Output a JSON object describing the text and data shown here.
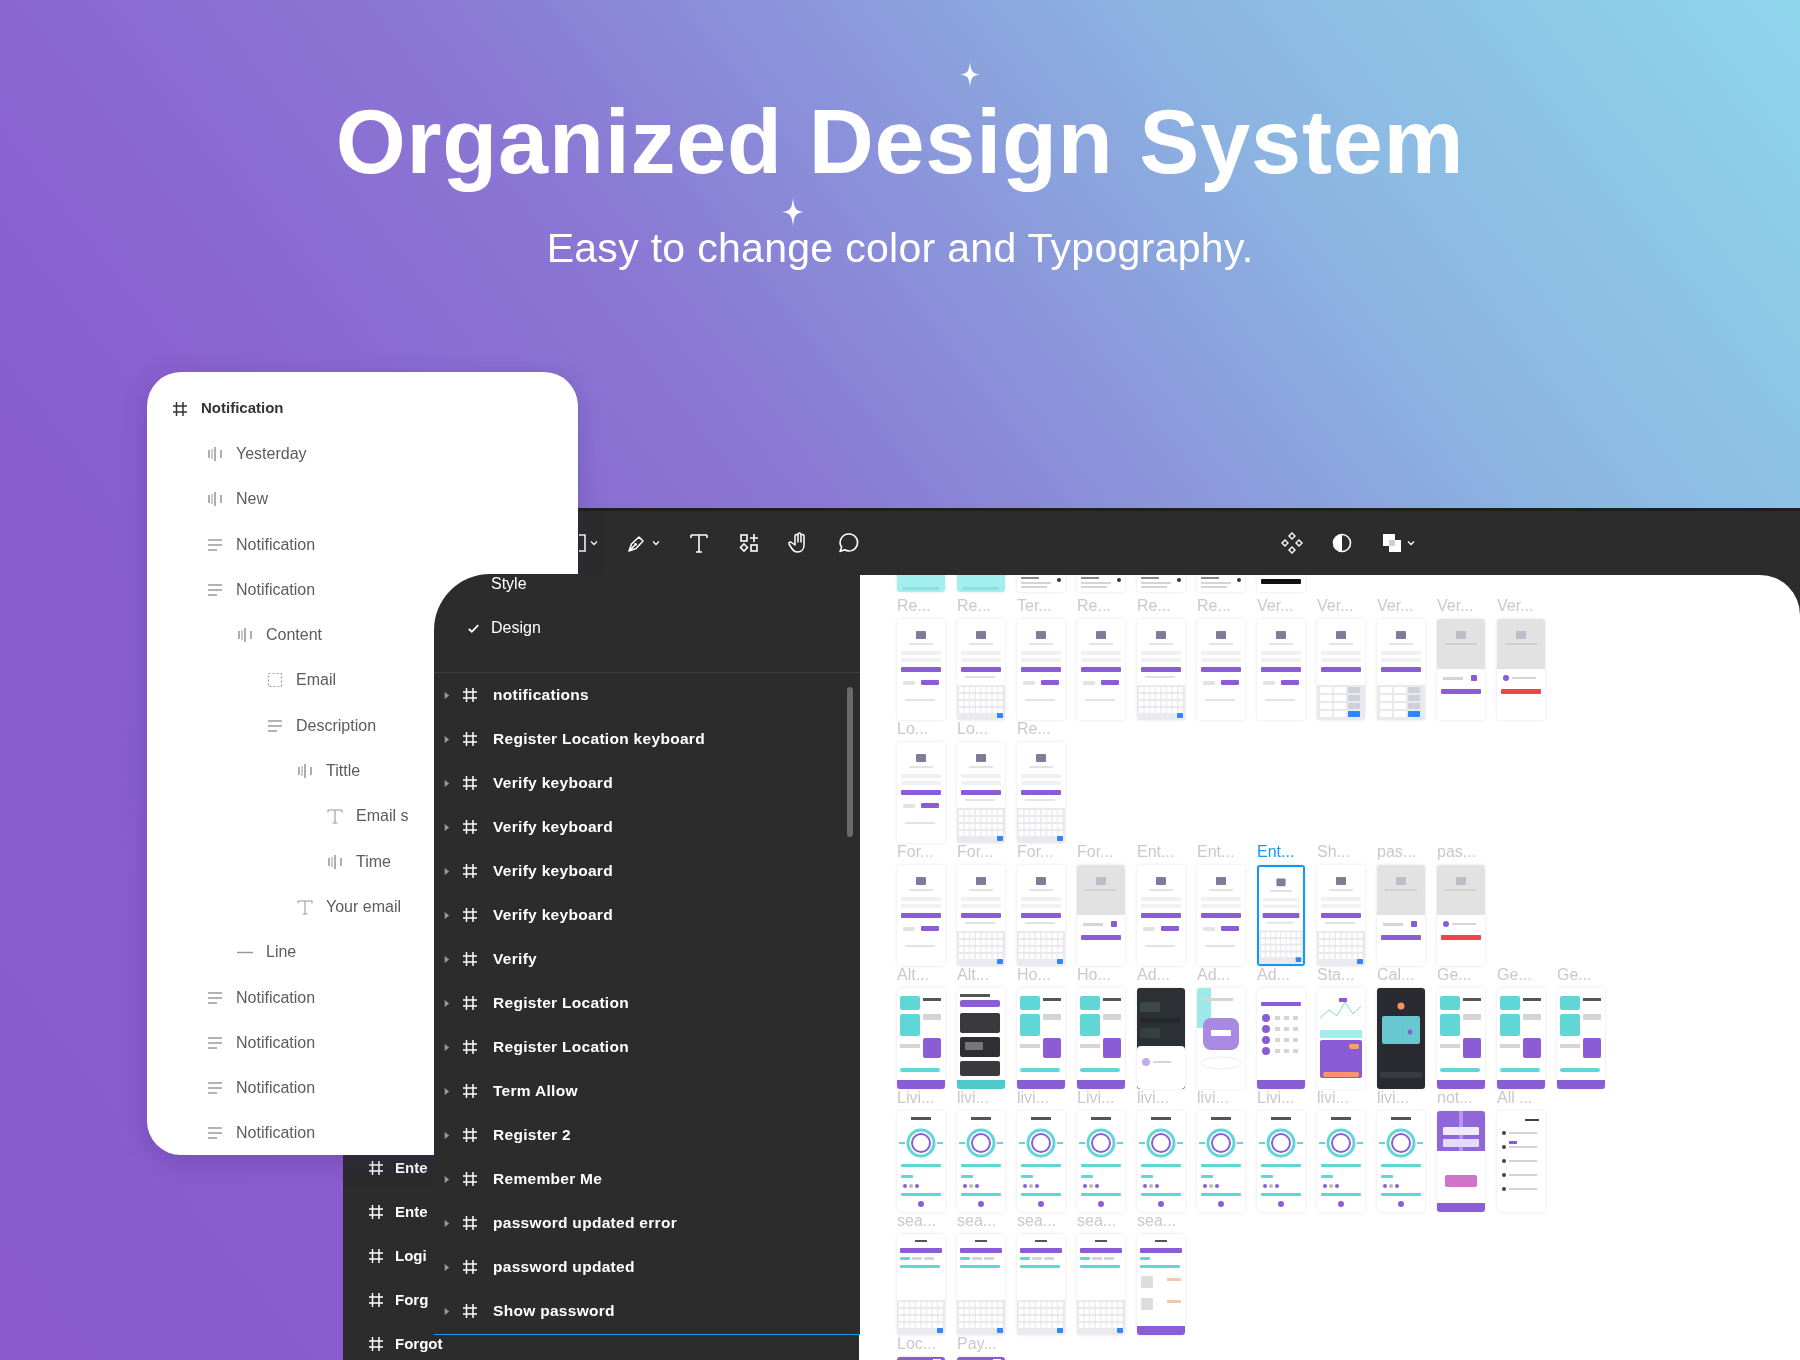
{
  "hero": {
    "title": "Organized Design System",
    "subtitle": "Easy to change color and Typography."
  },
  "toolbar": {
    "tools": [
      {
        "kind": "frame",
        "menu": true
      },
      {
        "kind": "pen",
        "menu": true
      },
      {
        "kind": "text",
        "menu": false
      },
      {
        "kind": "shapes",
        "menu": false
      },
      {
        "kind": "hand",
        "menu": false
      },
      {
        "kind": "comment",
        "menu": false
      }
    ],
    "actions": [
      {
        "kind": "component",
        "menu": false
      },
      {
        "kind": "contrast",
        "menu": false
      },
      {
        "kind": "layers",
        "menu": true
      }
    ]
  },
  "back_layers": [
    {
      "label": "Ente"
    },
    {
      "label": "Ente"
    },
    {
      "label": "Logi"
    },
    {
      "label": "Forg"
    },
    {
      "label": "Forgot"
    }
  ],
  "layers_panel": {
    "root": {
      "label": "Notification",
      "kind": "frame",
      "children": [
        {
          "label": "Yesterday",
          "kind": "autolayout"
        },
        {
          "label": "New",
          "kind": "autolayout"
        },
        {
          "label": "Notification",
          "kind": "stack"
        },
        {
          "label": "Notification",
          "kind": "stack",
          "children": [
            {
              "label": "Content",
              "kind": "autolayout",
              "children": [
                {
                  "label": "Email",
                  "kind": "placeholder"
                },
                {
                  "label": "Description",
                  "kind": "stack",
                  "children": [
                    {
                      "label": "Tittle",
                      "kind": "autolayout",
                      "children": [
                        {
                          "label": "Email s",
                          "kind": "text"
                        },
                        {
                          "label": "Time",
                          "kind": "autolayout"
                        }
                      ]
                    },
                    {
                      "label": "Your email",
                      "kind": "text"
                    }
                  ]
                }
              ]
            },
            {
              "label": "Line",
              "kind": "line"
            }
          ]
        },
        {
          "label": "Notification",
          "kind": "stack"
        },
        {
          "label": "Notification",
          "kind": "stack"
        },
        {
          "label": "Notification",
          "kind": "stack"
        },
        {
          "label": "Notification",
          "kind": "stack"
        }
      ]
    }
  },
  "pages_panel": {
    "options": [
      {
        "label": "Style",
        "checked": false
      },
      {
        "label": "Design",
        "checked": true
      }
    ],
    "frames": [
      {
        "label": "notifications",
        "expanded": false
      },
      {
        "label": "Register Location keyboard",
        "expanded": false
      },
      {
        "label": "Verify keyboard",
        "expanded": false
      },
      {
        "label": "Verify keyboard",
        "expanded": false
      },
      {
        "label": "Verify keyboard",
        "expanded": false
      },
      {
        "label": "Verify keyboard",
        "expanded": false
      },
      {
        "label": "Verify",
        "expanded": false
      },
      {
        "label": "Register Location",
        "expanded": false
      },
      {
        "label": "Register Location",
        "expanded": false
      },
      {
        "label": "Term Allow",
        "expanded": false
      },
      {
        "label": "Register 2",
        "expanded": false
      },
      {
        "label": "Remember Me",
        "expanded": false
      },
      {
        "label": "password updated error",
        "expanded": false
      },
      {
        "label": "password updated",
        "expanded": false
      },
      {
        "label": "Show password",
        "expanded": false
      }
    ]
  },
  "canvas": {
    "rows": [
      {
        "frames": [
          {
            "kind": "strip-teal",
            "selected": false
          },
          {
            "kind": "strip-teal",
            "selected": false
          },
          {
            "kind": "strip-light",
            "selected": false
          },
          {
            "kind": "strip-light",
            "selected": false
          },
          {
            "kind": "strip-light",
            "selected": false
          },
          {
            "kind": "strip-light",
            "selected": false
          },
          {
            "kind": "strip-dark",
            "selected": false
          }
        ]
      },
      {
        "frames": [
          {
            "label": "Re...",
            "kind": "form",
            "selected": false
          },
          {
            "label": "Re...",
            "kind": "keyboard",
            "selected": false
          },
          {
            "label": "Ter...",
            "kind": "form",
            "selected": false
          },
          {
            "label": "Re...",
            "kind": "form",
            "selected": false
          },
          {
            "label": "Re...",
            "kind": "keyboard",
            "selected": false
          },
          {
            "label": "Re...",
            "kind": "form",
            "selected": false
          },
          {
            "label": "Ver...",
            "kind": "form",
            "selected": false
          },
          {
            "label": "Ver...",
            "kind": "numpad",
            "selected": false
          },
          {
            "label": "Ver...",
            "kind": "numpad",
            "selected": false
          },
          {
            "label": "Ver...",
            "kind": "dialog",
            "selected": false
          },
          {
            "label": "Ver...",
            "kind": "dialog-error",
            "selected": false
          }
        ]
      },
      {
        "frames": [
          {
            "label": "Lo...",
            "kind": "form",
            "selected": false
          },
          {
            "label": "Lo...",
            "kind": "keyboard",
            "selected": false
          },
          {
            "label": "Re...",
            "kind": "keyboard",
            "selected": false
          }
        ]
      },
      {
        "frames": [
          {
            "label": "For...",
            "kind": "form",
            "selected": false
          },
          {
            "label": "For...",
            "kind": "keyboard",
            "selected": false
          },
          {
            "label": "For...",
            "kind": "keyboard",
            "selected": false
          },
          {
            "label": "For...",
            "kind": "dialog",
            "selected": false
          },
          {
            "label": "Ent...",
            "kind": "form",
            "selected": false
          },
          {
            "label": "Ent...",
            "kind": "form",
            "selected": false
          },
          {
            "label": "Ent...",
            "kind": "keyboard",
            "selected": true
          },
          {
            "label": "Sh...",
            "kind": "keyboard",
            "selected": false
          },
          {
            "label": "pas...",
            "kind": "dialog",
            "selected": false
          },
          {
            "label": "pas...",
            "kind": "dialog-error",
            "selected": false
          }
        ]
      },
      {
        "frames": [
          {
            "label": "Alt...",
            "kind": "dashboard",
            "selected": false
          },
          {
            "label": "Alt...",
            "kind": "photos",
            "selected": false
          },
          {
            "label": "Ho...",
            "kind": "dashboard",
            "selected": false
          },
          {
            "label": "Ho...",
            "kind": "dashboard",
            "selected": false
          },
          {
            "label": "Ad...",
            "kind": "dark",
            "selected": false
          },
          {
            "label": "Ad...",
            "kind": "device",
            "selected": false
          },
          {
            "label": "Ad...",
            "kind": "list",
            "selected": false
          },
          {
            "label": "Sta...",
            "kind": "stats",
            "selected": false
          },
          {
            "label": "Cal...",
            "kind": "calendar",
            "selected": false
          },
          {
            "label": "Ge...",
            "kind": "dashboard",
            "selected": false
          },
          {
            "label": "Ge...",
            "kind": "dashboard",
            "selected": false
          },
          {
            "label": "Ge...",
            "kind": "dashboard",
            "selected": false
          }
        ]
      },
      {
        "frames": [
          {
            "label": "Livi...",
            "kind": "gauge",
            "selected": false
          },
          {
            "label": "livi...",
            "kind": "gauge",
            "selected": false
          },
          {
            "label": "livi...",
            "kind": "gauge",
            "selected": false
          },
          {
            "label": "Livi...",
            "kind": "gauge",
            "selected": false
          },
          {
            "label": "livi...",
            "kind": "gauge",
            "selected": false
          },
          {
            "label": "livi...",
            "kind": "gauge",
            "selected": false
          },
          {
            "label": "Livi...",
            "kind": "gauge",
            "selected": false
          },
          {
            "label": "livi...",
            "kind": "gauge",
            "selected": false
          },
          {
            "label": "livi...",
            "kind": "gauge",
            "selected": false
          },
          {
            "label": "not...",
            "kind": "promo",
            "selected": false
          },
          {
            "label": "All ...",
            "kind": "feed",
            "selected": false
          }
        ]
      },
      {
        "frames": [
          {
            "label": "sea...",
            "kind": "search",
            "selected": false
          },
          {
            "label": "sea...",
            "kind": "search",
            "selected": false
          },
          {
            "label": "sea...",
            "kind": "search",
            "selected": false
          },
          {
            "label": "sea...",
            "kind": "search",
            "selected": false
          },
          {
            "label": "sea...",
            "kind": "search-list",
            "selected": false
          }
        ]
      },
      {
        "frames": [
          {
            "label": "Loc...",
            "kind": "strip-purple",
            "selected": false
          },
          {
            "label": "Pay...",
            "kind": "strip-purple",
            "selected": false
          }
        ]
      }
    ]
  }
}
